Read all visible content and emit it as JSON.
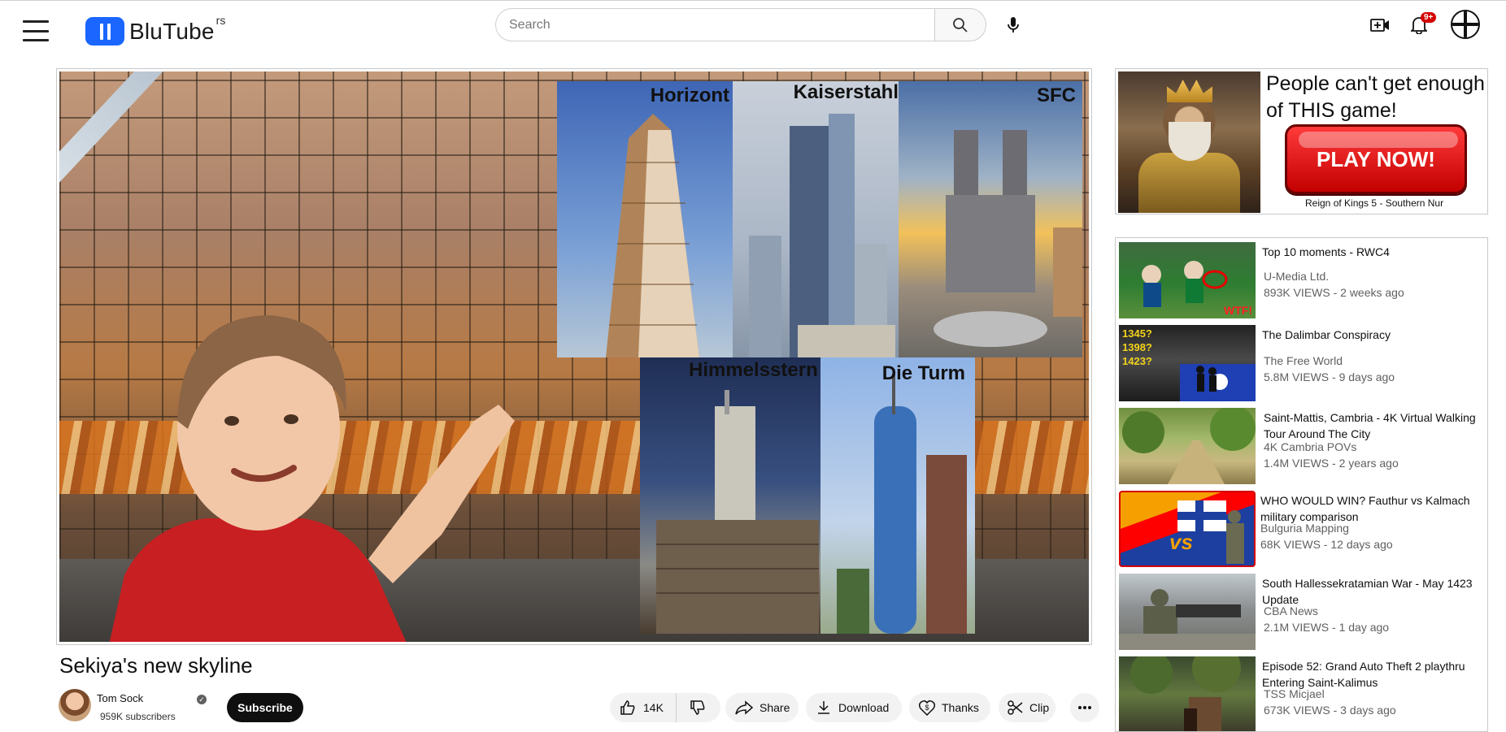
{
  "app": {
    "logo_text": "BluTube",
    "logo_superscript": "rs",
    "search_placeholder": "Search",
    "notification_count": "9+"
  },
  "video": {
    "title": "Sekiya's new skyline",
    "thumbnail_labels": [
      "Horizont",
      "Kaiserstahl",
      "SFC",
      "Himmelsstern",
      "Die Turm"
    ]
  },
  "channel": {
    "name": "Tom Sock",
    "subscribers": "959K subscribers",
    "subscribe_label": "Subscribe"
  },
  "actions": {
    "likes": "14K",
    "share_label": "Share",
    "download_label": "Download",
    "thanks_label": "Thanks",
    "clip_label": "Clip"
  },
  "ad": {
    "headline": "People can't get enough of THIS game!",
    "button_label": "PLAY NOW!",
    "caption": "Reign of Kings 5 - Southern Nur"
  },
  "recommendations": [
    {
      "title": "Top 10 moments - RWC4",
      "channel": "U-Media Ltd.",
      "views": "893K VIEWS - 2 weeks ago",
      "thumb_overlay": "WTF!"
    },
    {
      "title": "The Dalimbar Conspiracy",
      "channel": "The Free World",
      "views": "5.8M VIEWS - 9 days ago",
      "thumb_overlay": "1345?\n1398?\n1423?"
    },
    {
      "title": "Saint-Mattis, Cambria - 4K Virtual Walking Tour Around The City",
      "channel": "4K Cambria POVs",
      "views": "1.4M VIEWS - 2 years ago"
    },
    {
      "title": "WHO WOULD WIN? Fauthur vs Kalmach military comparison",
      "channel": "Bulguria Mapping",
      "views": "68K VIEWS - 12 days ago",
      "thumb_overlay": "vs"
    },
    {
      "title": "South Hallessekratamian War - May 1423 Update",
      "channel": "CBA News",
      "views": "2.1M VIEWS - 1 day ago"
    },
    {
      "title": "Episode 52: Grand Auto Theft 2 playthru Entering Saint-Kalimus",
      "channel": "TSS Micjael",
      "views": "673K VIEWS - 3 days ago"
    }
  ],
  "colors": {
    "brand": "#1a66ff",
    "subscribe_bg": "#0f0f0f",
    "badge": "#d40000"
  }
}
